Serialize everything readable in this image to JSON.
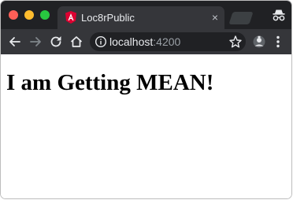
{
  "browser": {
    "tab": {
      "title": "Loc8rPublic",
      "close_label": "×"
    },
    "address": {
      "host": "localhost",
      "port": ":4200"
    }
  },
  "page": {
    "heading": "I am Getting MEAN!"
  },
  "colors": {
    "titlebar": "#202124",
    "toolbar": "#35363a",
    "angular_red": "#dd0031",
    "traffic_red": "#ff5f57",
    "traffic_yellow": "#febc2e",
    "traffic_green": "#28c840"
  },
  "icons": [
    "close-window-icon",
    "minimize-window-icon",
    "maximize-window-icon",
    "angular-favicon",
    "incognito-icon",
    "back-arrow-icon",
    "forward-arrow-icon",
    "reload-icon",
    "home-icon",
    "info-icon",
    "bookmark-star-icon",
    "extension-icon",
    "more-menu-icon"
  ]
}
